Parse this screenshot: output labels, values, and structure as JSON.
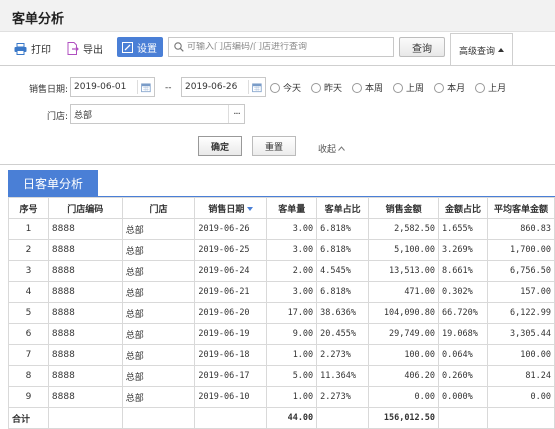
{
  "page": {
    "title": "客单分析"
  },
  "toolbar": {
    "print_label": "打印",
    "export_label": "导出",
    "settings_label": "设置",
    "search_placeholder": "可输入门店编码/门店进行查询",
    "search_label": "查询",
    "advanced_label": "高级查询"
  },
  "filter": {
    "date_label": "销售日期:",
    "date_from": "2019-06-01",
    "date_sep": "--",
    "date_to": "2019-06-26",
    "quick_ranges": [
      "今天",
      "昨天",
      "本周",
      "上周",
      "本月",
      "上月"
    ],
    "store_label": "门店:",
    "store_value": "总部",
    "store_more": "···",
    "confirm_label": "确定",
    "reset_label": "重置",
    "collapse_label": "收起"
  },
  "section": {
    "tab_label": "日客单分析"
  },
  "table": {
    "headers": [
      "序号",
      "门店编码",
      "门店",
      "销售日期",
      "客单量",
      "客单占比",
      "销售金额",
      "金额占比",
      "平均客单金额"
    ],
    "rows": [
      [
        "1",
        "8888",
        "总部",
        "2019-06-26",
        "3.00",
        "6.818%",
        "2,582.50",
        "1.655%",
        "860.83"
      ],
      [
        "2",
        "8888",
        "总部",
        "2019-06-25",
        "3.00",
        "6.818%",
        "5,100.00",
        "3.269%",
        "1,700.00"
      ],
      [
        "3",
        "8888",
        "总部",
        "2019-06-24",
        "2.00",
        "4.545%",
        "13,513.00",
        "8.661%",
        "6,756.50"
      ],
      [
        "4",
        "8888",
        "总部",
        "2019-06-21",
        "3.00",
        "6.818%",
        "471.00",
        "0.302%",
        "157.00"
      ],
      [
        "5",
        "8888",
        "总部",
        "2019-06-20",
        "17.00",
        "38.636%",
        "104,090.80",
        "66.720%",
        "6,122.99"
      ],
      [
        "6",
        "8888",
        "总部",
        "2019-06-19",
        "9.00",
        "20.455%",
        "29,749.00",
        "19.068%",
        "3,305.44"
      ],
      [
        "7",
        "8888",
        "总部",
        "2019-06-18",
        "1.00",
        "2.273%",
        "100.00",
        "0.064%",
        "100.00"
      ],
      [
        "8",
        "8888",
        "总部",
        "2019-06-17",
        "5.00",
        "11.364%",
        "406.20",
        "0.260%",
        "81.24"
      ],
      [
        "9",
        "8888",
        "总部",
        "2019-06-10",
        "1.00",
        "2.273%",
        "0.00",
        "0.000%",
        "0.00"
      ]
    ],
    "total": {
      "label": "合计",
      "count": "44.00",
      "amount": "156,012.50"
    }
  },
  "colors": {
    "accent": "#4a7fd6",
    "print_icon": "#3a78c8",
    "export_icon": "#b050c0"
  }
}
